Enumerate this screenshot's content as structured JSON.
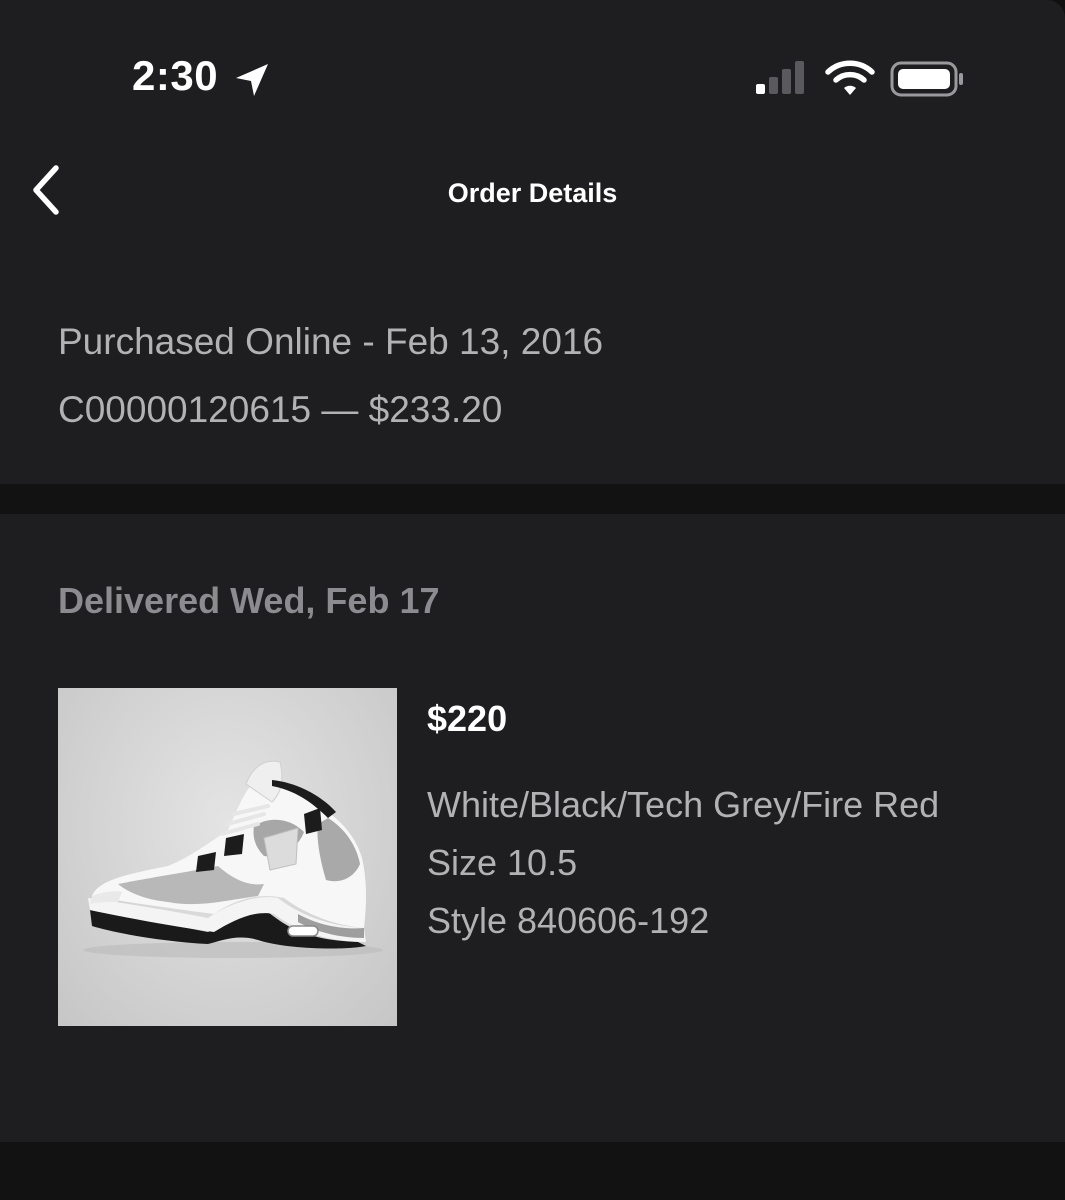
{
  "status_bar": {
    "time": "2:30",
    "icons": [
      "location-arrow-icon",
      "cellular-signal-icon",
      "wifi-icon",
      "battery-icon"
    ]
  },
  "nav": {
    "back_icon": "chevron-left-icon",
    "title": "Order Details"
  },
  "order": {
    "purchase_line": "Purchased Online - Feb 13, 2016",
    "order_line": "C00000120615 — $233.20"
  },
  "delivery": {
    "status": "Delivered Wed, Feb 17",
    "item": {
      "price": "$220",
      "color": "White/Black/Tech Grey/Fire Red",
      "size": "Size 10.5",
      "style": "Style 840606-192"
    }
  },
  "colors": {
    "background": "#1e1e20",
    "divider": "#121213",
    "primary_text": "#ffffff",
    "secondary_text": "#b2b2b5",
    "muted_text": "#8c8c90"
  }
}
